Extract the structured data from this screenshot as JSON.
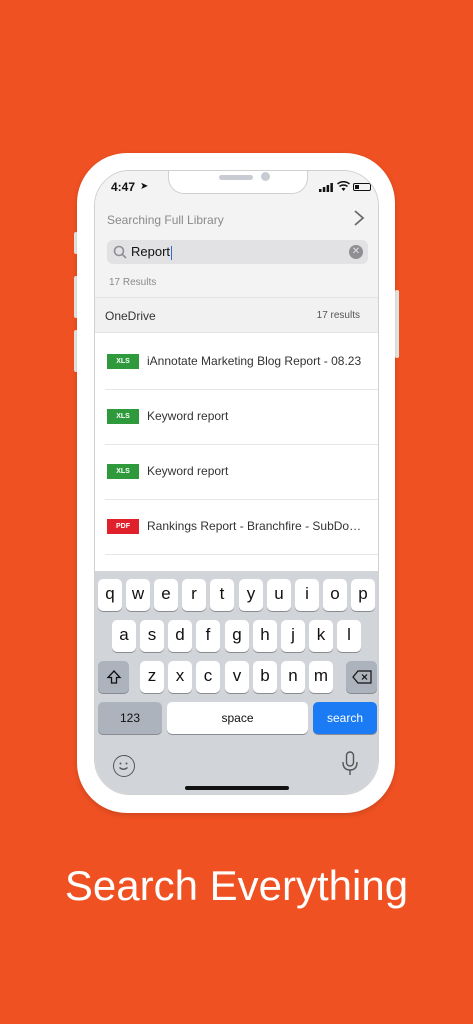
{
  "status_bar": {
    "time": "4:47"
  },
  "header": {
    "title": "Searching Full Library",
    "search": {
      "value": "Report"
    },
    "result_count": "17 Results"
  },
  "section": {
    "title": "OneDrive",
    "count": "17 results"
  },
  "files": [
    {
      "type": "XLS",
      "name": "iAnnotate Marketing Blog Report - 08.23",
      "color": "#2e9a3c"
    },
    {
      "type": "XLS",
      "name": "Keyword report",
      "color": "#2e9a3c"
    },
    {
      "type": "XLS",
      "name": "Keyword report",
      "color": "#2e9a3c"
    },
    {
      "type": "PDF",
      "name": "Rankings Report - Branchfire - SubDo…",
      "color": "#e0202a"
    }
  ],
  "keyboard": {
    "row1": [
      "q",
      "w",
      "e",
      "r",
      "t",
      "y",
      "u",
      "i",
      "o",
      "p"
    ],
    "row2": [
      "a",
      "s",
      "d",
      "f",
      "g",
      "h",
      "j",
      "k",
      "l"
    ],
    "row3": [
      "z",
      "x",
      "c",
      "v",
      "b",
      "n",
      "m"
    ],
    "numbers_label": "123",
    "space_label": "space",
    "search_label": "search"
  },
  "tagline": "Search Everything",
  "colors": {
    "background": "#F05122",
    "accent": "#1a7bf5"
  }
}
